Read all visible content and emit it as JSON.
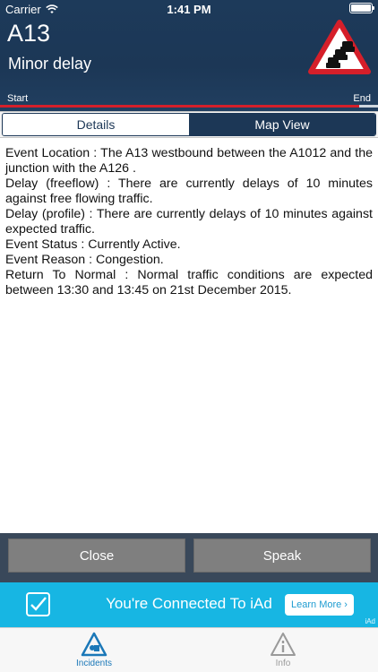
{
  "status_bar": {
    "carrier": "Carrier",
    "time": "1:41 PM",
    "icons": [
      "wifi-icon",
      "battery-icon"
    ]
  },
  "incident": {
    "road": "A13",
    "severity": "Minor delay",
    "start_label": "Start",
    "end_label": "End",
    "progress_fraction": 0.95,
    "colors": {
      "header": "#1c3756",
      "progress": "#d51f2a"
    }
  },
  "tabs": {
    "details_label": "Details",
    "map_label": "Map View",
    "selected": "Details"
  },
  "details": {
    "lines": [
      "Event Location : The A13 westbound between the A1012  and the junction with the A126 .",
      "Delay (freeflow) : There are currently delays of 10 minutes against free flowing traffic.",
      "Delay (profile) : There are currently delays of 10 minutes against expected traffic.",
      "Event Status : Currently Active.",
      "Event Reason : Congestion.",
      "Return To Normal : Normal traffic conditions are expected between 13:30 and 13:45 on 21st December 2015."
    ]
  },
  "actions": {
    "close_label": "Close",
    "speak_label": "Speak"
  },
  "ad": {
    "text": "You're Connected To iAd",
    "learn_more": "Learn More ›",
    "mark": "iAd",
    "color": "#17b6e3"
  },
  "tabbar": {
    "incidents_label": "Incidents",
    "info_label": "Info",
    "selected": "Incidents",
    "accent": "#1b78b8"
  }
}
